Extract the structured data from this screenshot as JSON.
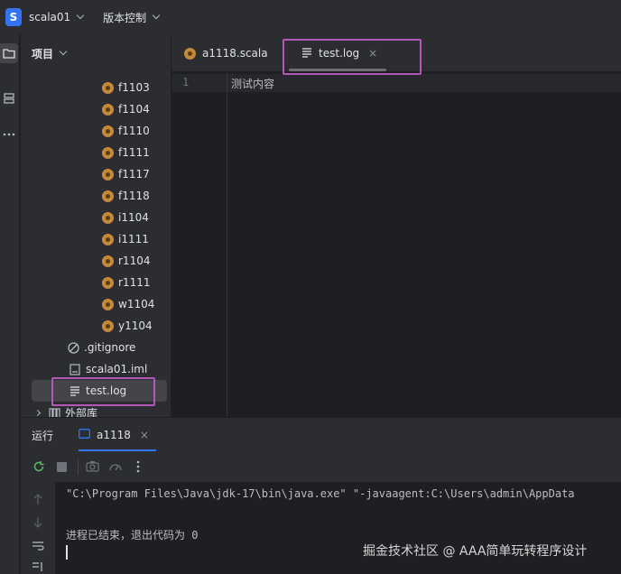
{
  "titlebar": {
    "project_initial": "S",
    "project_name": "scala01",
    "vcs_label": "版本控制"
  },
  "project_panel": {
    "title": "项目",
    "items": [
      {
        "label": "f1103",
        "icon": "scala-object-icon"
      },
      {
        "label": "f1104",
        "icon": "scala-object-icon"
      },
      {
        "label": "f1110",
        "icon": "scala-object-icon"
      },
      {
        "label": "f1111",
        "icon": "scala-object-icon"
      },
      {
        "label": "f1117",
        "icon": "scala-object-icon"
      },
      {
        "label": "f1118",
        "icon": "scala-object-icon"
      },
      {
        "label": "i1104",
        "icon": "scala-object-icon"
      },
      {
        "label": "i1111",
        "icon": "scala-object-icon"
      },
      {
        "label": "r1104",
        "icon": "scala-object-icon"
      },
      {
        "label": "r1111",
        "icon": "scala-object-icon"
      },
      {
        "label": "w1104",
        "icon": "scala-object-icon"
      },
      {
        "label": "y1104",
        "icon": "scala-object-icon"
      },
      {
        "label": ".gitignore",
        "icon": "ignored-file-icon"
      },
      {
        "label": "scala01.iml",
        "icon": "module-file-icon"
      },
      {
        "label": "test.log",
        "icon": "text-file-icon"
      },
      {
        "label": "外部库",
        "icon": "library-icon"
      }
    ]
  },
  "editor": {
    "tabs": [
      {
        "label": "a1118.scala",
        "icon": "scala-object-icon"
      },
      {
        "label": "test.log",
        "icon": "text-file-icon",
        "active": true
      }
    ],
    "close_glyph": "×",
    "line_number": "1",
    "content": "测试内容"
  },
  "run_panel": {
    "title": "运行",
    "tab_label": "a1118",
    "console_lines": [
      "\"C:\\Program Files\\Java\\jdk-17\\bin\\java.exe\" \"-javaagent:C:\\Users\\admin\\AppData",
      "进程已结束，退出代码为 0"
    ]
  },
  "watermark": "掘金技术社区 @ AAA简单玩转程序设计",
  "colors": {
    "accent": "#3574f0",
    "annotation": "#b557b8",
    "scala_icon": "#c28a3a"
  }
}
